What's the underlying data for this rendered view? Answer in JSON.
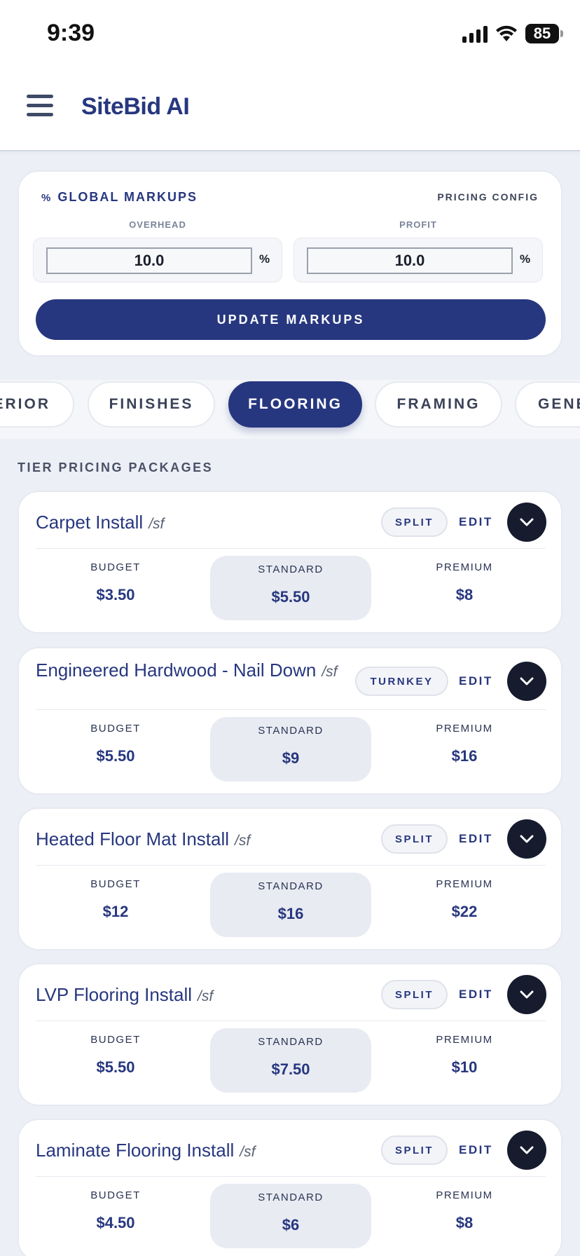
{
  "status_bar": {
    "time": "9:39",
    "battery": "85"
  },
  "header": {
    "title": "SiteBid AI"
  },
  "markups": {
    "title": "GLOBAL MARKUPS",
    "title_icon": "%",
    "config_label": "PRICING CONFIG",
    "overhead_label": "OVERHEAD",
    "overhead_value": "10.0",
    "profit_label": "PROFIT",
    "profit_value": "10.0",
    "unit": "%",
    "update_label": "UPDATE MARKUPS"
  },
  "tabs": [
    {
      "label": "ERIOR",
      "active": false
    },
    {
      "label": "FINISHES",
      "active": false
    },
    {
      "label": "FLOORING",
      "active": true
    },
    {
      "label": "FRAMING",
      "active": false
    },
    {
      "label": "GENE",
      "active": false
    }
  ],
  "section_heading": "TIER PRICING PACKAGES",
  "tier_labels": {
    "budget": "BUDGET",
    "standard": "STANDARD",
    "premium": "PREMIUM"
  },
  "edit_label": "EDIT",
  "packages": [
    {
      "name": "Carpet Install",
      "unit": "/sf",
      "badge": "SPLIT",
      "budget": "$3.50",
      "standard": "$5.50",
      "premium": "$8"
    },
    {
      "name": "Engineered Hardwood - Nail Down",
      "unit": "/sf",
      "badge": "TURNKEY",
      "budget": "$5.50",
      "standard": "$9",
      "premium": "$16"
    },
    {
      "name": "Heated Floor Mat Install",
      "unit": "/sf",
      "badge": "SPLIT",
      "budget": "$12",
      "standard": "$16",
      "premium": "$22"
    },
    {
      "name": "LVP Flooring Install",
      "unit": "/sf",
      "badge": "SPLIT",
      "budget": "$5.50",
      "standard": "$7.50",
      "premium": "$10"
    },
    {
      "name": "Laminate Flooring Install",
      "unit": "/sf",
      "badge": "SPLIT",
      "budget": "$4.50",
      "standard": "$6",
      "premium": "$8"
    }
  ],
  "icons": {
    "menu": "hamburger-icon",
    "toggle": "chevron-down-icon",
    "signal": "cellular-signal-icon",
    "wifi": "wifi-icon",
    "battery": "battery-icon"
  },
  "colors": {
    "brand": "#27377f",
    "background": "#eceff5",
    "toggle": "#161b2e"
  }
}
